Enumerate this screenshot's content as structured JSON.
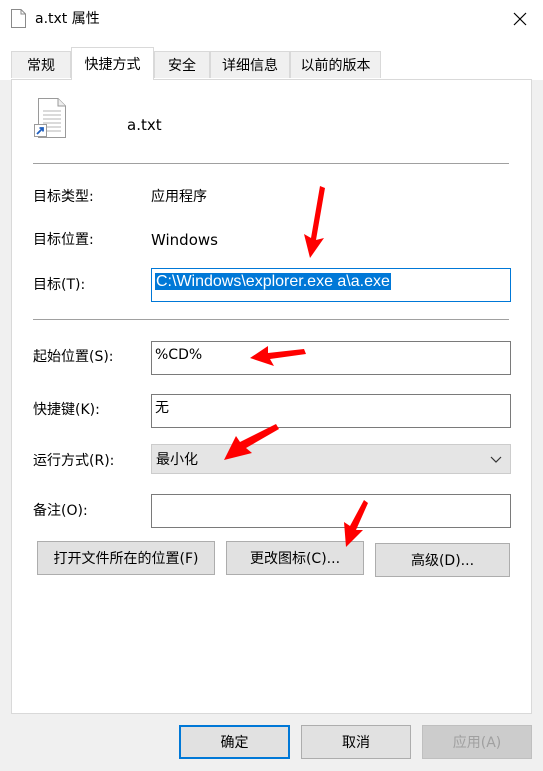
{
  "window": {
    "title": "a.txt 属性"
  },
  "tabs": [
    {
      "label": "常规"
    },
    {
      "label": "快捷方式"
    },
    {
      "label": "安全"
    },
    {
      "label": "详细信息"
    },
    {
      "label": "以前的版本"
    }
  ],
  "file": {
    "name": "a.txt"
  },
  "fields": {
    "target_type": {
      "label": "目标类型:",
      "value": "应用程序"
    },
    "target_location": {
      "label": "目标位置:",
      "value": "Windows"
    },
    "target": {
      "label": "目标(T):",
      "value": "C:\\Windows\\explorer.exe a\\a.exe"
    },
    "start_in": {
      "label": "起始位置(S):",
      "value": "%CD%"
    },
    "shortcut_key": {
      "label": "快捷键(K):",
      "value": "无"
    },
    "run": {
      "label": "运行方式(R):",
      "value": "最小化"
    },
    "comment": {
      "label": "备注(O):",
      "value": ""
    }
  },
  "buttons": {
    "open_location": "打开文件所在的位置(F)",
    "change_icon": "更改图标(C)...",
    "advanced": "高级(D)...",
    "ok": "确定",
    "cancel": "取消",
    "apply": "应用(A)"
  },
  "colors": {
    "accent": "#0078d7",
    "annotation": "#ff0000"
  }
}
